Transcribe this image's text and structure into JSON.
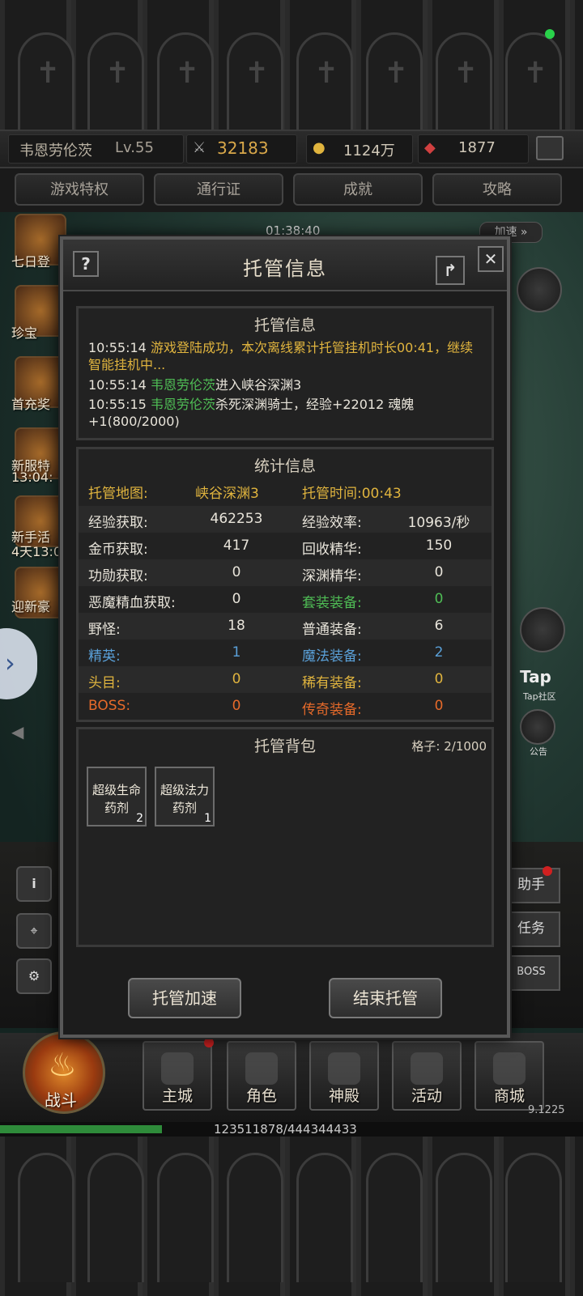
{
  "player": {
    "name": "韦恩劳伦茨",
    "level": "Lv.55",
    "power": "32183",
    "gold": "1124万",
    "gems": "1877"
  },
  "privileges": [
    "游戏特权",
    "通行证",
    "成就",
    "攻略"
  ],
  "scene": {
    "timer": "01:38:40",
    "speed_btn": "加速",
    "left_icons": [
      {
        "label": "七日登"
      },
      {
        "label": "珍宝"
      },
      {
        "label": "首充奖"
      },
      {
        "label": "新服特",
        "sub": "13:04:"
      },
      {
        "label": "新手活",
        "sub": "4天13:0"
      },
      {
        "label": "迎新豪"
      }
    ],
    "right_icons": [
      {
        "label": "Tap",
        "sub": "Tap社区"
      },
      {
        "label": "公告"
      }
    ],
    "right_tabs": [
      "助手",
      "任务",
      "BOSS"
    ]
  },
  "dialog": {
    "title": "托管信息",
    "help_label": "?",
    "close_label": "✕",
    "log_panel": {
      "title": "托管信息",
      "entries": [
        {
          "time": "10:55:14",
          "parts": [
            {
              "text": "游戏登陆成功，本次离线累计托管挂机时长00:41，继续智能挂机中...",
              "color": "yellow"
            }
          ]
        },
        {
          "time": "10:55:14",
          "parts": [
            {
              "text": "韦恩劳伦茨",
              "color": "green"
            },
            {
              "text": "进入峡谷深渊3",
              "color": "white"
            }
          ]
        },
        {
          "time": "10:55:15",
          "parts": [
            {
              "text": "韦恩劳伦茨",
              "color": "green"
            },
            {
              "text": "杀死深渊骑士，经验+22012 魂魄+1(800/2000)",
              "color": "white"
            }
          ]
        }
      ]
    },
    "stats_panel": {
      "title": "统计信息",
      "map_label": "托管地图:",
      "map_value": "峡谷深渊3",
      "time_label": "托管时间:00:43",
      "rows": [
        {
          "l1": "经验获取:",
          "v1": "462253",
          "l2": "经验效率:",
          "v2": "10963/秒",
          "c1": "white",
          "c2": "white"
        },
        {
          "l1": "金币获取:",
          "v1": "417",
          "l2": "回收精华:",
          "v2": "150",
          "c1": "white",
          "c2": "white"
        },
        {
          "l1": "功勋获取:",
          "v1": "0",
          "l2": "深渊精华:",
          "v2": "0",
          "c1": "white",
          "c2": "white"
        },
        {
          "l1": "恶魔精血获取:",
          "v1": "0",
          "l2": "套装装备:",
          "v2": "0",
          "c1": "white",
          "c2": "green"
        },
        {
          "l1": "野怪:",
          "v1": "18",
          "l2": "普通装备:",
          "v2": "6",
          "c1": "white",
          "c2": "white"
        },
        {
          "l1": "精英:",
          "v1": "1",
          "l2": "魔法装备:",
          "v2": "2",
          "c1": "blue",
          "c2": "blue"
        },
        {
          "l1": "头目:",
          "v1": "0",
          "l2": "稀有装备:",
          "v2": "0",
          "c1": "yellow",
          "c2": "yellow"
        },
        {
          "l1": "BOSS:",
          "v1": "0",
          "l2": "传奇装备:",
          "v2": "0",
          "c1": "orange",
          "c2": "orange"
        }
      ]
    },
    "bag_panel": {
      "title": "托管背包",
      "slots_label": "格子: 2/1000",
      "items": [
        {
          "name": "超级生命药剂",
          "count": "2"
        },
        {
          "name": "超级法力药剂",
          "count": "1"
        }
      ]
    },
    "buttons": {
      "speedup": "托管加速",
      "end": "结束托管"
    }
  },
  "nav": {
    "items": [
      "战斗",
      "主城",
      "角色",
      "神殿",
      "活动",
      "商城"
    ],
    "version": "9.1225",
    "exp_text": "123511878/444344433",
    "exp_progress": 0.278
  },
  "colors": {
    "yellow": "#e0b43e",
    "green": "#4fbd55",
    "white": "#e8e4da",
    "blue": "#5aa0d8",
    "orange": "#e66a2a"
  }
}
